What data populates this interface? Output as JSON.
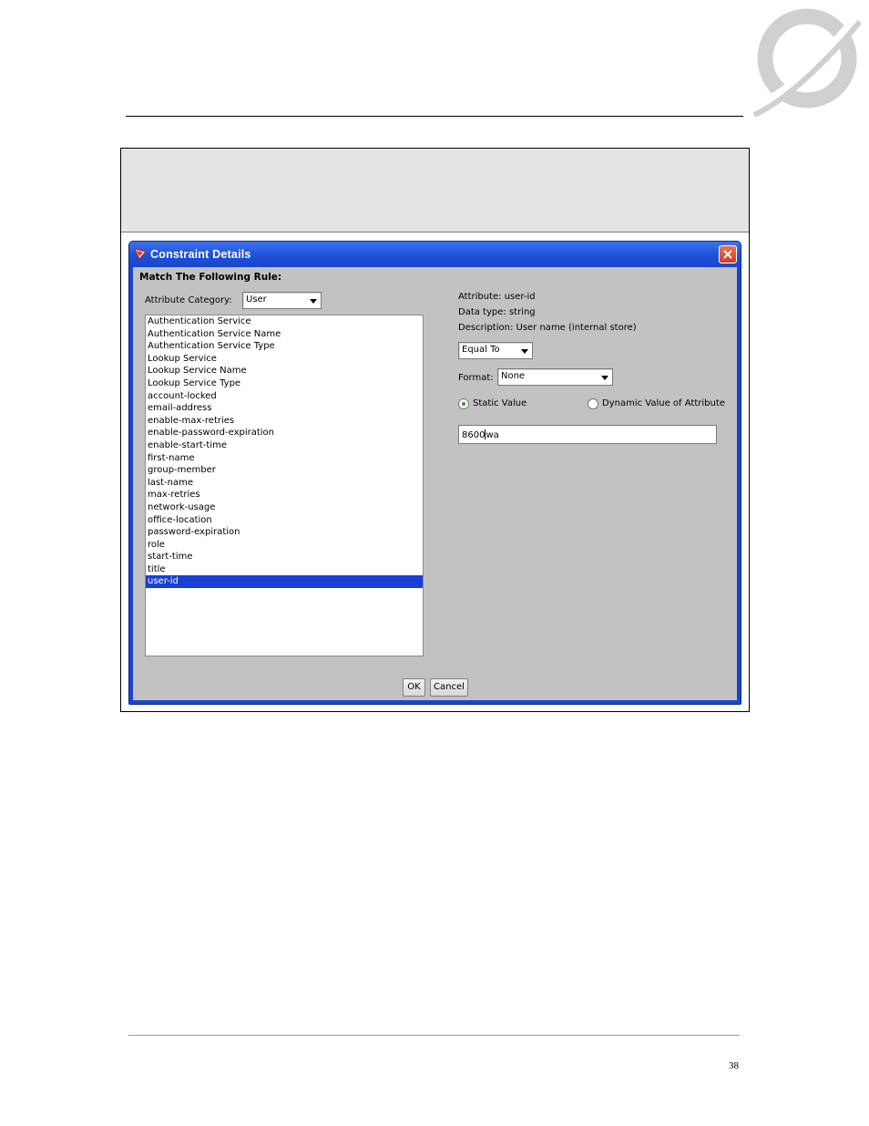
{
  "dialog": {
    "title": "Constraint Details",
    "rule_heading": "Match The Following Rule:",
    "category_label": "Attribute Category:",
    "category_value": "User",
    "attributes": [
      "Authentication Service",
      "Authentication Service Name",
      "Authentication Service Type",
      "Lookup Service",
      "Lookup Service Name",
      "Lookup Service Type",
      "account-locked",
      "email-address",
      "enable-max-retries",
      "enable-password-expiration",
      "enable-start-time",
      "first-name",
      "group-member",
      "last-name",
      "max-retries",
      "network-usage",
      "office-location",
      "password-expiration",
      "role",
      "start-time",
      "title",
      "user-id"
    ],
    "selected_attribute": "user-id",
    "info": {
      "attribute": "Attribute:  user-id",
      "data_type": "Data type:  string",
      "description": "Description:  User name (internal store)"
    },
    "operator_value": "Equal To",
    "format_label": "Format:",
    "format_value": "None",
    "static_value_label": "Static Value",
    "dynamic_value_label": "Dynamic Value of Attribute",
    "value_before_caret": "8600",
    "value_after_caret": "wa",
    "ok_label": "OK",
    "cancel_label": "Cancel"
  },
  "page_number": "38",
  "colors": {
    "title_bar": "#1f50d8",
    "dialog_body": "#c2c2c2",
    "selection": "#1a3fd4",
    "close_button": "#cf3f1c"
  }
}
